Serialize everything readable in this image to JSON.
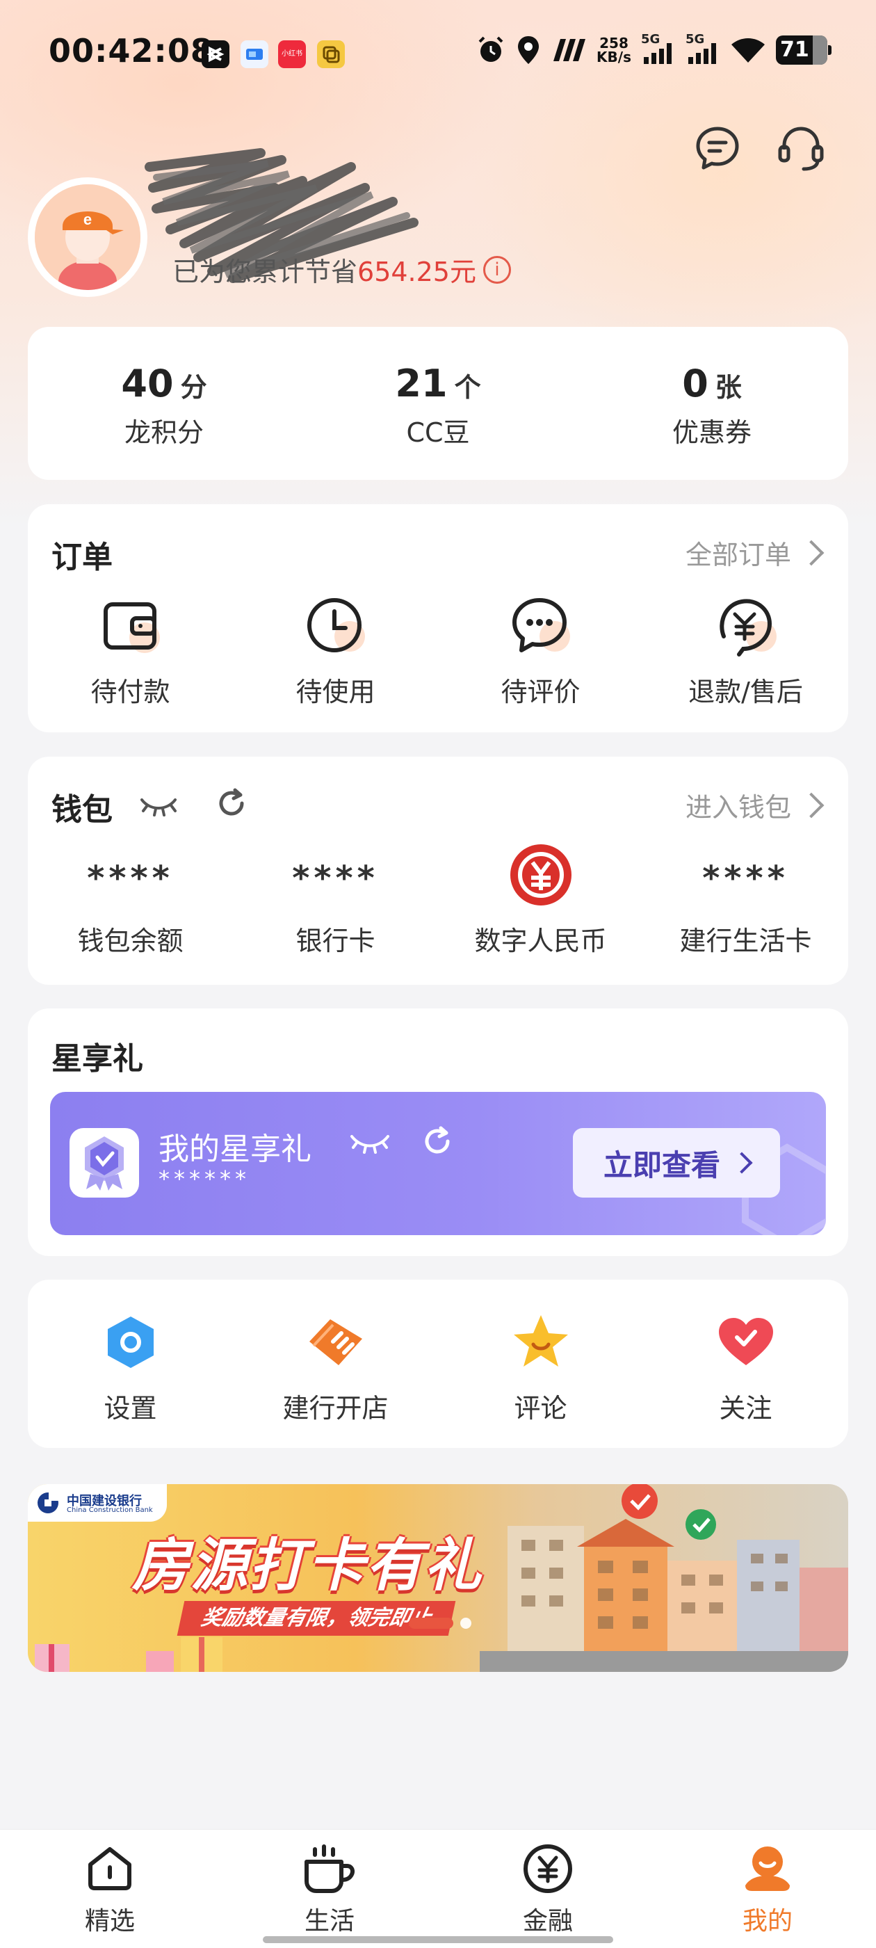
{
  "status_bar": {
    "time": "00:42:08",
    "apps": [
      "capcut-icon",
      "app-blue-icon",
      "xiaohongshu-icon",
      "app-yellow-icon"
    ],
    "xiaohongshu_label": "小红书",
    "speed_value": "258",
    "speed_unit": "KB/s",
    "network_1": "5G",
    "network_2": "5G",
    "battery": "71",
    "battery_level": 0.71
  },
  "header": {
    "savings_prefix": "已为您累计节省",
    "savings_amount": "654.25元"
  },
  "stats": [
    {
      "value": "40",
      "unit": "分",
      "label": "龙积分"
    },
    {
      "value": "21",
      "unit": "个",
      "label": "CC豆"
    },
    {
      "value": "0",
      "unit": "张",
      "label": "优惠券"
    }
  ],
  "orders": {
    "title": "订单",
    "more": "全部订单",
    "items": [
      {
        "label": "待付款",
        "icon": "wallet-icon"
      },
      {
        "label": "待使用",
        "icon": "clock-icon"
      },
      {
        "label": "待评价",
        "icon": "chat-icon"
      },
      {
        "label": "退款/售后",
        "icon": "refund-icon"
      }
    ]
  },
  "wallet": {
    "title": "钱包",
    "more": "进入钱包",
    "items": [
      {
        "value": "****",
        "label": "钱包余额"
      },
      {
        "value": "****",
        "label": "银行卡"
      },
      {
        "value": "",
        "label": "数字人民币"
      },
      {
        "value": "****",
        "label": "建行生活卡"
      }
    ]
  },
  "star_gift": {
    "title": "星享礼",
    "card_title": "我的星享礼",
    "card_value": "******",
    "button": "立即查看"
  },
  "tools": [
    {
      "label": "设置",
      "icon": "settings-icon"
    },
    {
      "label": "建行开店",
      "icon": "shop-icon"
    },
    {
      "label": "评论",
      "icon": "star-icon"
    },
    {
      "label": "关注",
      "icon": "heart-icon"
    }
  ],
  "banner": {
    "bank_name": "中国建设银行",
    "bank_name_en": "China Construction Bank",
    "title": "房源打卡有礼",
    "subtitle": "奖励数量有限，领完即止"
  },
  "tabbar": [
    {
      "label": "精选",
      "icon": "home-icon",
      "active": false
    },
    {
      "label": "生活",
      "icon": "cup-icon",
      "active": false
    },
    {
      "label": "金融",
      "icon": "finance-icon",
      "active": false
    },
    {
      "label": "我的",
      "icon": "profile-icon",
      "active": true
    }
  ],
  "colors": {
    "accent": "#f07a2a",
    "savings": "#e0403a",
    "promo": "#8c7ff0"
  }
}
